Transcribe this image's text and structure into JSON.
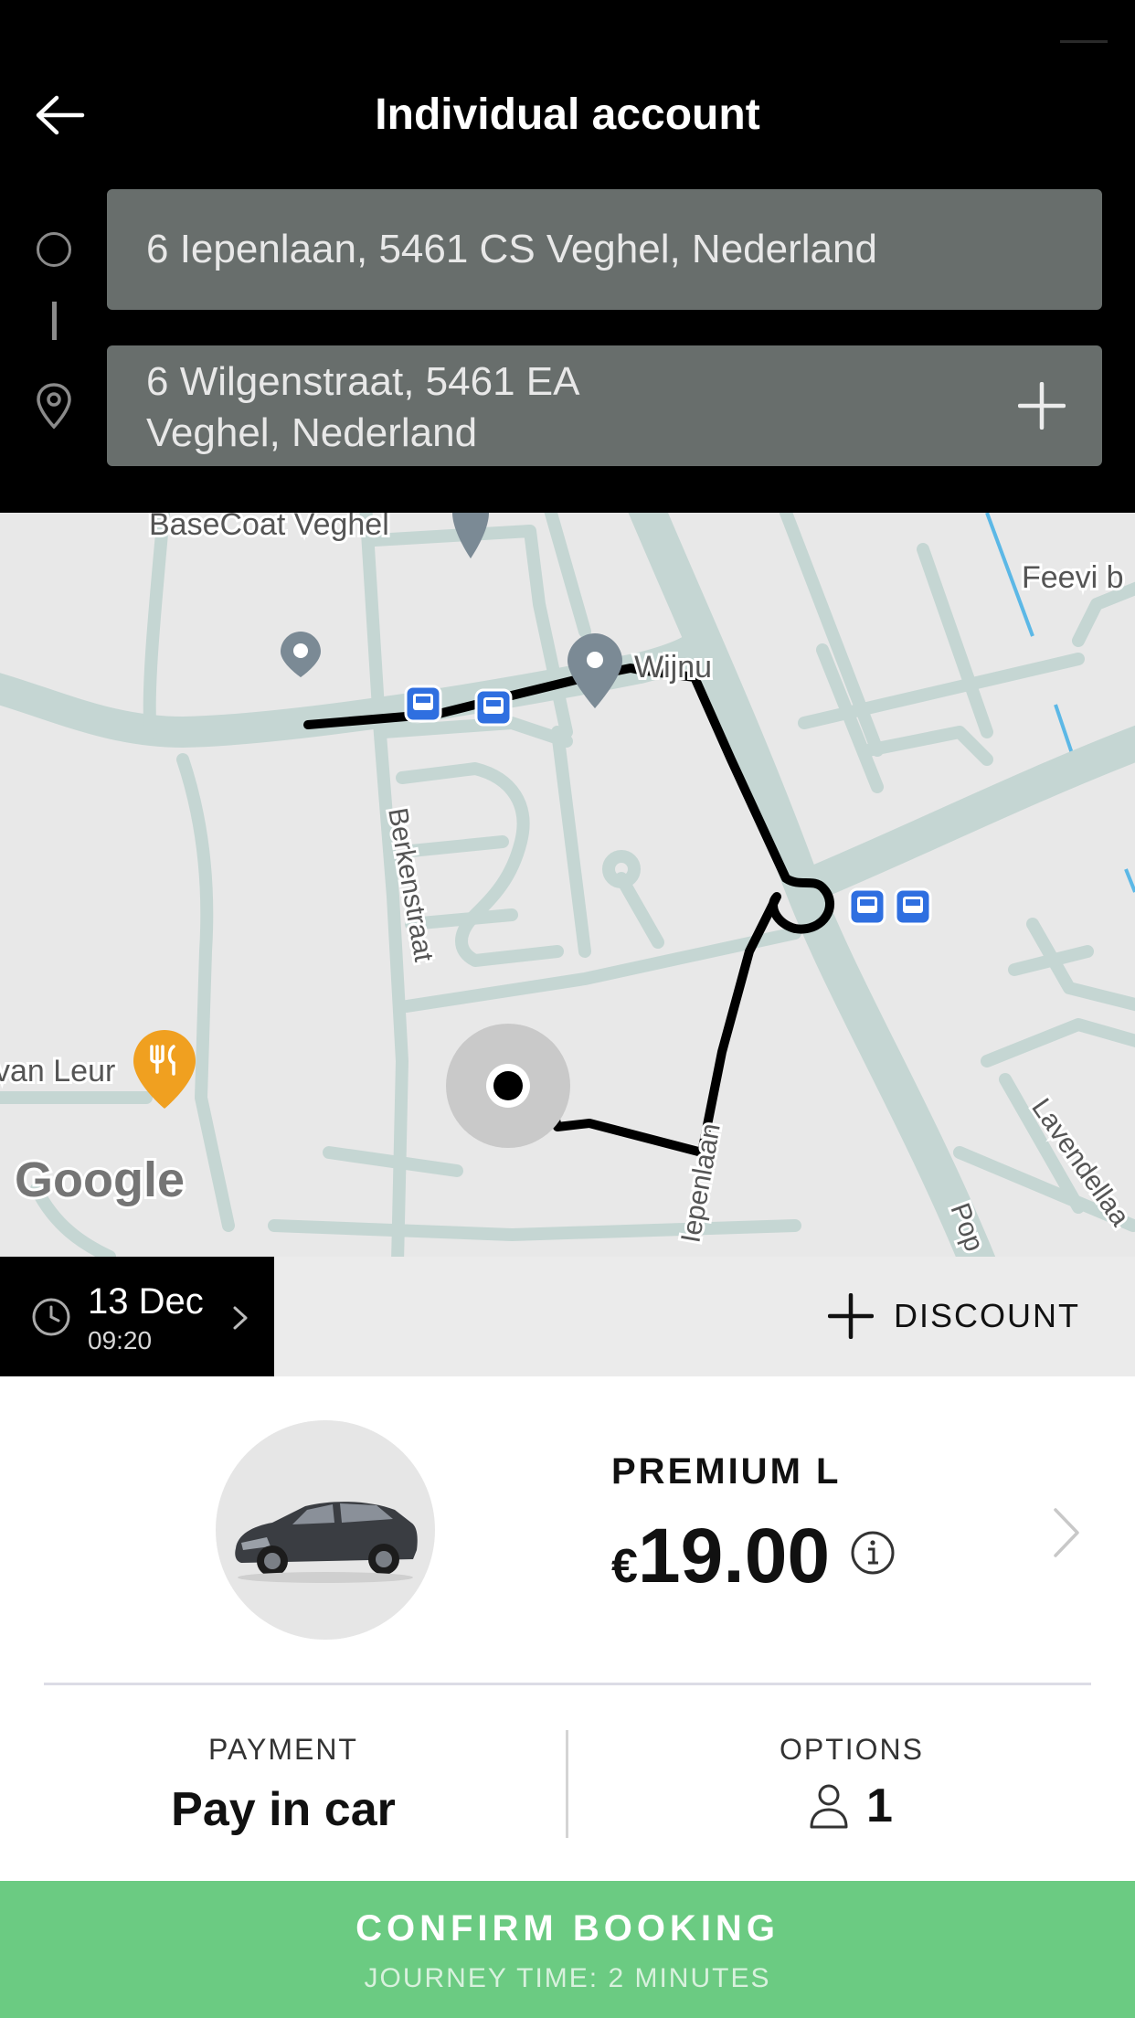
{
  "header": {
    "title": "Individual account",
    "back_icon": "arrow-left-icon",
    "origin_address": "6 Iepenlaan, 5461 CS Veghel, Nederland",
    "destination_address": "6 Wilgenstraat, 5461 EA Veghel, Nederland",
    "add_stop_icon": "plus-icon"
  },
  "map": {
    "labels": {
      "basecoat": "BaseCoat Veghel",
      "feevi": "Feevi b",
      "wijnu": "Wijnu",
      "berkenstraat": "Berkenstraat",
      "iepenlaan": "Iepenlaan",
      "lavendel": "Lavendellaa",
      "pop": "Pop",
      "vanleur": "van Leur",
      "google": "Google"
    },
    "colors": {
      "background": "#e8e8e8",
      "road": "#c5d6d3",
      "route": "#000000",
      "water": "#5cb8e6",
      "transit": "#2f6fe0",
      "restaurant": "#f0a020"
    }
  },
  "schedule": {
    "date": "13 Dec",
    "time": "09:20",
    "discount_label": "DISCOUNT"
  },
  "vehicle": {
    "name": "PREMIUM L",
    "currency": "€",
    "price": "19.00"
  },
  "payment": {
    "label": "PAYMENT",
    "value": "Pay in car"
  },
  "options": {
    "label": "OPTIONS",
    "passengers": "1"
  },
  "confirm": {
    "label": "CONFIRM BOOKING",
    "sub": "JOURNEY TIME: 2 MINUTES"
  },
  "colors": {
    "header_bg": "#000000",
    "address_field": "#686e6c",
    "confirm_bg": "#6bcb82"
  }
}
